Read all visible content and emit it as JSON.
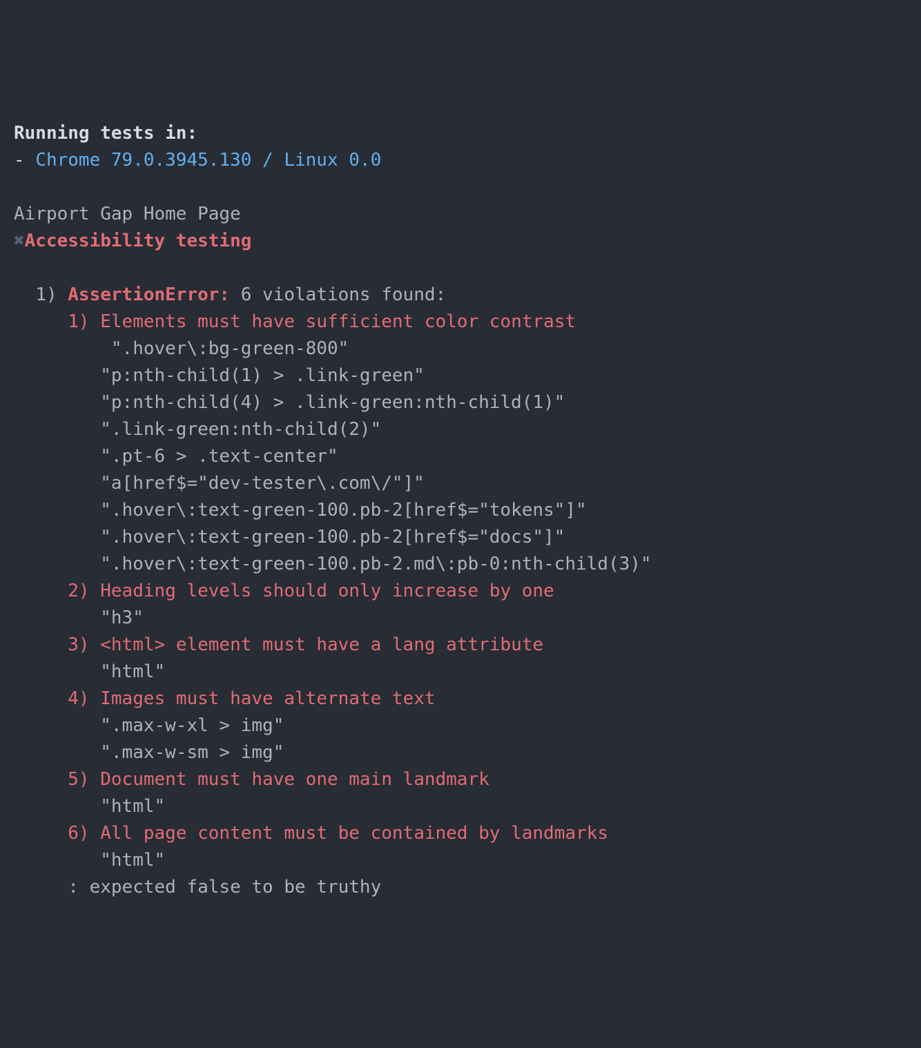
{
  "header": {
    "running_in_label": "Running tests in:",
    "bullet": "- ",
    "browser": "Chrome 79.0.3945.130 / Linux 0.0"
  },
  "suite": {
    "name": "Airport Gap Home Page",
    "status_icon": "✖",
    "test_name": "Accessibility testing"
  },
  "error": {
    "number": "1)",
    "label": "AssertionError:",
    "summary": "6 violations found:",
    "violations": [
      {
        "num": "1)",
        "title": "Elements must have sufficient color contrast",
        "selectors": [
          " \".hover\\:bg-green-800\"",
          "\"p:nth-child(1) > .link-green\"",
          "\"p:nth-child(4) > .link-green:nth-child(1)\"",
          "\".link-green:nth-child(2)\"",
          "\".pt-6 > .text-center\"",
          "\"a[href$=\"dev-tester\\.com\\/\"]\"",
          "\".hover\\:text-green-100.pb-2[href$=\"tokens\"]\"",
          "\".hover\\:text-green-100.pb-2[href$=\"docs\"]\"",
          "\".hover\\:text-green-100.pb-2.md\\:pb-0:nth-child(3)\""
        ]
      },
      {
        "num": "2)",
        "title": "Heading levels should only increase by one",
        "selectors": [
          "\"h3\""
        ]
      },
      {
        "num": "3)",
        "title": "<html> element must have a lang attribute",
        "selectors": [
          "\"html\""
        ]
      },
      {
        "num": "4)",
        "title": "Images must have alternate text",
        "selectors": [
          "\".max-w-xl > img\"",
          "\".max-w-sm > img\""
        ]
      },
      {
        "num": "5)",
        "title": "Document must have one main landmark",
        "selectors": [
          "\"html\""
        ]
      },
      {
        "num": "6)",
        "title": "All page content must be contained by landmarks",
        "selectors": [
          "\"html\""
        ]
      }
    ],
    "footer": ": expected false to be truthy"
  }
}
